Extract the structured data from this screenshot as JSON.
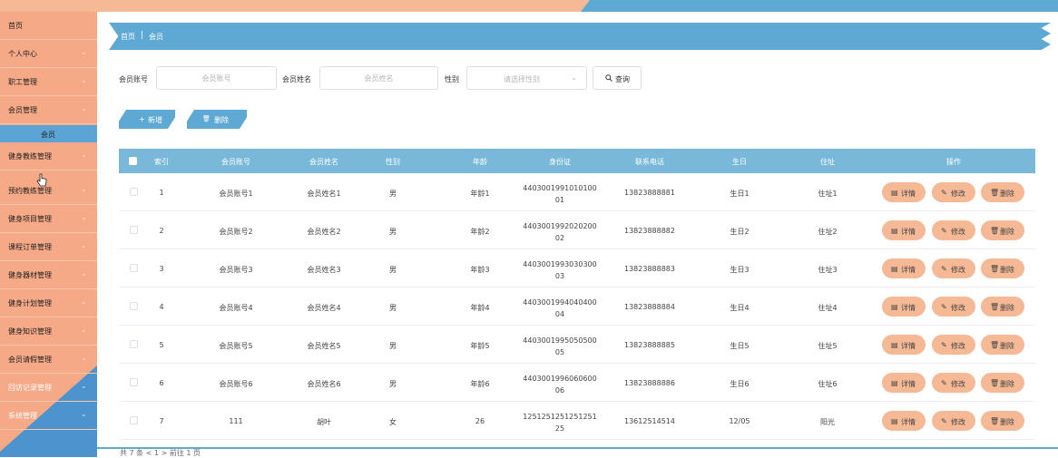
{
  "sidebar": {
    "items": [
      {
        "label": "首页"
      },
      {
        "label": "个人中心"
      },
      {
        "label": "职工管理"
      },
      {
        "label": "会员管理"
      },
      {
        "label": "健身教练管理"
      },
      {
        "label": "预约教练管理"
      },
      {
        "label": "健身项目管理"
      },
      {
        "label": "课程订单管理"
      },
      {
        "label": "健身器材管理"
      },
      {
        "label": "健身计划管理"
      },
      {
        "label": "健身知识管理"
      },
      {
        "label": "会员请假管理"
      },
      {
        "label": "回访记录管理"
      },
      {
        "label": "系统管理"
      }
    ],
    "sub_item": "会员",
    "chevron": "⌄"
  },
  "breadcrumb": {
    "home": "首页",
    "separator": "|",
    "current": "会员"
  },
  "search": {
    "account_label": "会员账号",
    "account_placeholder": "会员账号",
    "name_label": "会员姓名",
    "name_placeholder": "会员姓名",
    "gender_label": "性别",
    "gender_placeholder": "请选择性别",
    "gender_arrow": "⌄",
    "search_icon": "search-icon",
    "search_label": "查询"
  },
  "actions": {
    "add_icon": "+",
    "add_label": "新增",
    "delete_icon": "🗑",
    "delete_label": "删除"
  },
  "table": {
    "headers": [
      "索引",
      "会员账号",
      "会员姓名",
      "性别",
      "年龄",
      "身份证",
      "联系电话",
      "生日",
      "住址",
      "操作"
    ],
    "rows": [
      {
        "index": "1",
        "account": "会员账号1",
        "name": "会员姓名1",
        "gender": "男",
        "age": "年龄1",
        "id_line1": "4403001991010100",
        "id_line2": "01",
        "phone": "13823888881",
        "birthday": "生日1",
        "address": "住址1"
      },
      {
        "index": "2",
        "account": "会员账号2",
        "name": "会员姓名2",
        "gender": "男",
        "age": "年龄2",
        "id_line1": "4403001992020200",
        "id_line2": "02",
        "phone": "13823888882",
        "birthday": "生日2",
        "address": "住址2"
      },
      {
        "index": "3",
        "account": "会员账号3",
        "name": "会员姓名3",
        "gender": "男",
        "age": "年龄3",
        "id_line1": "4403001993030300",
        "id_line2": "03",
        "phone": "13823888883",
        "birthday": "生日3",
        "address": "住址3"
      },
      {
        "index": "4",
        "account": "会员账号4",
        "name": "会员姓名4",
        "gender": "男",
        "age": "年龄4",
        "id_line1": "4403001994040400",
        "id_line2": "04",
        "phone": "13823888884",
        "birthday": "生日4",
        "address": "住址4"
      },
      {
        "index": "5",
        "account": "会员账号5",
        "name": "会员姓名5",
        "gender": "男",
        "age": "年龄5",
        "id_line1": "4403001995050500",
        "id_line2": "05",
        "phone": "13823888885",
        "birthday": "生日5",
        "address": "住址5"
      },
      {
        "index": "6",
        "account": "会员账号6",
        "name": "会员姓名6",
        "gender": "男",
        "age": "年龄6",
        "id_line1": "4403001996060600",
        "id_line2": "06",
        "phone": "13823888886",
        "birthday": "生日6",
        "address": "住址6"
      },
      {
        "index": "7",
        "account": "111",
        "name": "胡叶",
        "gender": "女",
        "age": "26",
        "id_line1": "1251251251251251",
        "id_line2": "25",
        "phone": "13612514514",
        "birthday": "12/05",
        "address": "阳光"
      }
    ],
    "row_ops": {
      "detail_label": "详情",
      "edit_label": "修改",
      "delete_label": "删除",
      "detail_icon": "▤",
      "edit_icon": "✎",
      "delete_icon": "🗑"
    }
  },
  "pager": {
    "text": "共 7 条    <    1    >    前往  1  页"
  },
  "colors": {
    "orange": "#f5a986",
    "blue": "#5ea9d3",
    "header_blue": "#7ab8da",
    "op_orange": "#f5b995"
  }
}
